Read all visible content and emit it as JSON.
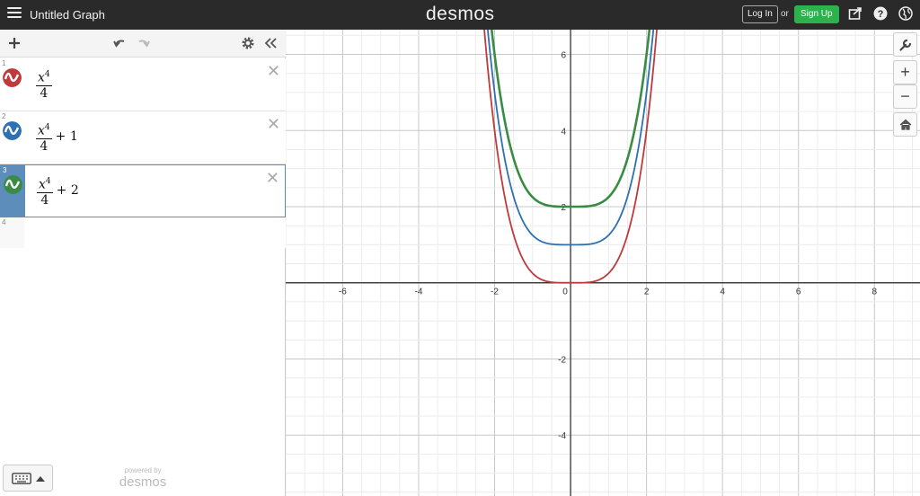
{
  "topbar": {
    "title": "Untitled Graph",
    "brand": "desmos",
    "login_label": "Log In",
    "or_text": "or",
    "signup_label": "Sign Up",
    "signup_color": "#2bb24c"
  },
  "expressions": [
    {
      "index": "1",
      "numerator_base": "x",
      "numerator_exp": "4",
      "denominator": "4",
      "tail": "",
      "color": "#c0393b"
    },
    {
      "index": "2",
      "numerator_base": "x",
      "numerator_exp": "4",
      "denominator": "4",
      "tail": "+ 1",
      "color": "#2d70b3"
    },
    {
      "index": "3",
      "numerator_base": "x",
      "numerator_exp": "4",
      "denominator": "4",
      "tail": "+ 2",
      "color": "#388c46",
      "selected": true
    },
    {
      "index": "4"
    }
  ],
  "powered_by": {
    "small": "powered by",
    "brand": "desmos"
  },
  "graph": {
    "x_range": [
      -7.5,
      9.2
    ],
    "y_range": [
      -5.6,
      6.65
    ],
    "x_ticks": [
      "-6",
      "-4",
      "-2",
      "0",
      "2",
      "4",
      "6",
      "8"
    ],
    "y_ticks": [
      "6",
      "4",
      "2",
      "-2",
      "-4"
    ],
    "origin_label": "0",
    "functions": [
      {
        "expr": "x^4/4",
        "shift": 0,
        "color": "#c0393b"
      },
      {
        "expr": "x^4/4 + 1",
        "shift": 1,
        "color": "#2d70b3"
      },
      {
        "expr": "x^4/4 + 2",
        "shift": 2,
        "color": "#388c46"
      }
    ]
  },
  "controls": {
    "zoom_in": "+",
    "zoom_out": "−"
  },
  "icons": {
    "menu": "hamburger-icon",
    "share": "share-icon",
    "help": "help-icon",
    "language": "globe-icon",
    "add": "plus-icon",
    "undo": "undo-icon",
    "redo": "redo-icon",
    "settings": "gear-icon",
    "collapse": "double-chevron-left-icon",
    "keyboard": "keyboard-icon",
    "wrench": "wrench-icon",
    "home": "home-icon"
  }
}
